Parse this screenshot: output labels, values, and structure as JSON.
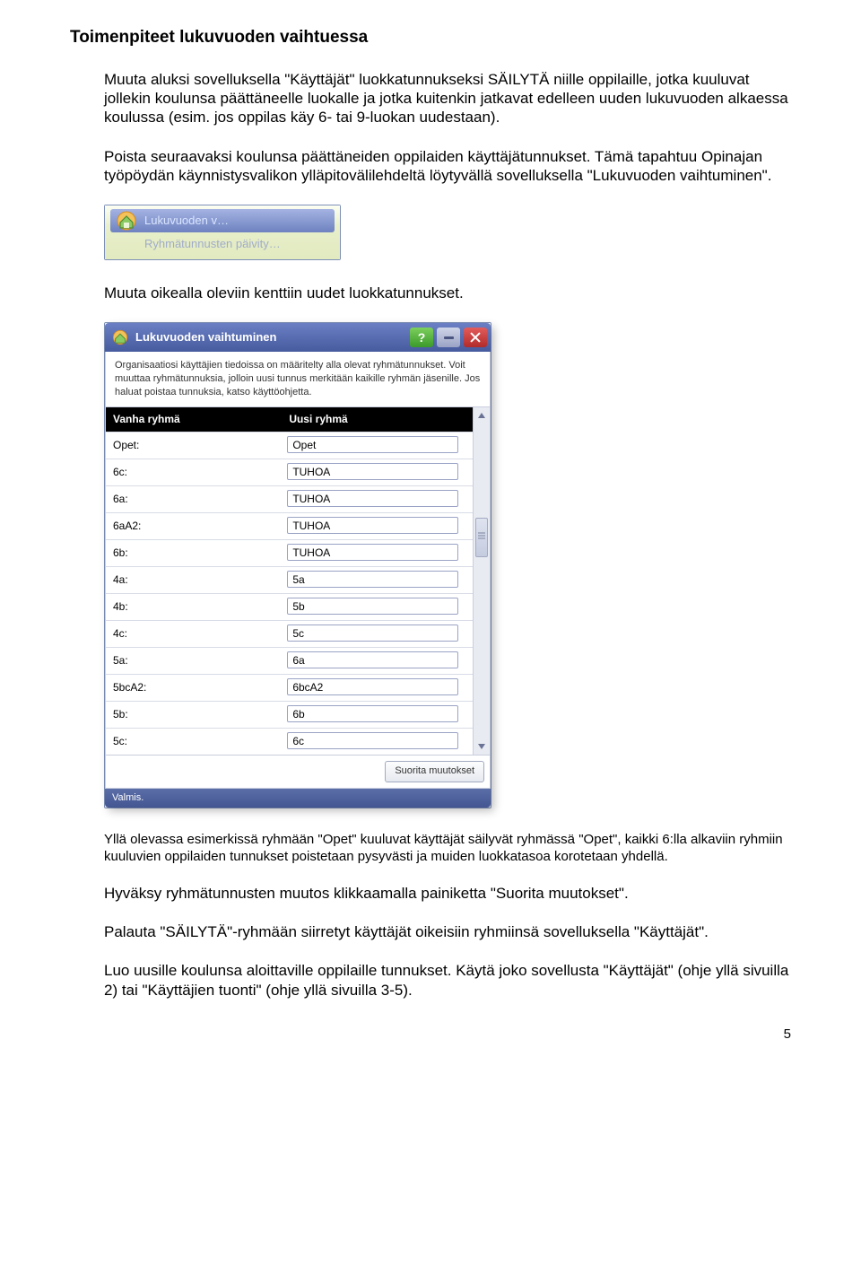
{
  "heading": "Toimenpiteet lukuvuoden vaihtuessa",
  "para1": "Muuta aluksi sovelluksella \"Käyttäjät\" luokkatunnukseksi SÄILYTÄ niille oppilaille, jotka kuuluvat jollekin koulunsa päättäneelle luokalle ja jotka kuitenkin jatkavat edelleen uuden lukuvuoden alkaessa koulussa (esim. jos oppilas käy 6- tai 9-luokan uudestaan).",
  "para2": "Poista seuraavaksi koulunsa päättäneiden oppilaiden käyttäjätunnukset. Tämä tapahtuu Opinajan työpöydän käynnistysvalikon ylläpitovälilehdeltä löytyvällä sovelluksella \"Lukuvuoden vaihtuminen\".",
  "launcher": {
    "item1": "Lukuvuoden v…",
    "item2": "Ryhmätunnusten päivity…"
  },
  "para3": "Muuta oikealla oleviin kenttiin uudet luokkatunnukset.",
  "dialog": {
    "title": "Lukuvuoden vaihtuminen",
    "description": "Organisaatiosi käyttäjien tiedoissa on määritelty alla olevat ryhmätunnukset. Voit muuttaa ryhmätunnuksia, jolloin uusi tunnus merkitään kaikille ryhmän jäsenille. Jos haluat poistaa tunnuksia, katso käyttöohjetta.",
    "col_left": "Vanha ryhmä",
    "col_right": "Uusi ryhmä",
    "rows": [
      {
        "old": "Opet:",
        "new": "Opet"
      },
      {
        "old": "6c:",
        "new": "TUHOA"
      },
      {
        "old": "6a:",
        "new": "TUHOA"
      },
      {
        "old": "6aA2:",
        "new": "TUHOA"
      },
      {
        "old": "6b:",
        "new": "TUHOA"
      },
      {
        "old": "4a:",
        "new": "5a"
      },
      {
        "old": "4b:",
        "new": "5b"
      },
      {
        "old": "4c:",
        "new": "5c"
      },
      {
        "old": "5a:",
        "new": "6a"
      },
      {
        "old": "5bcA2:",
        "new": "6bcA2"
      },
      {
        "old": "5b:",
        "new": "6b"
      },
      {
        "old": "5c:",
        "new": "6c"
      }
    ],
    "action_button": "Suorita muutokset",
    "status": "Valmis."
  },
  "para4": "Yllä olevassa esimerkissä ryhmään \"Opet\" kuuluvat käyttäjät säilyvät ryhmässä \"Opet\", kaikki 6:lla alkaviin ryhmiin kuuluvien oppilaiden tunnukset poistetaan pysyvästi ja muiden luokkatasoa korotetaan yhdellä.",
  "para5": "Hyväksy ryhmätunnusten muutos klikkaamalla painiketta \"Suorita muutokset\".",
  "para6": "Palauta \"SÄILYTÄ\"-ryhmään siirretyt käyttäjät oikeisiin ryhmiinsä sovelluksella \"Käyttäjät\".",
  "para7": "Luo uusille koulunsa aloittaville oppilaille tunnukset. Käytä joko sovellusta \"Käyttäjät\" (ohje yllä sivuilla 2) tai \"Käyttäjien tuonti\" (ohje yllä sivuilla 3-5).",
  "page_number": "5"
}
